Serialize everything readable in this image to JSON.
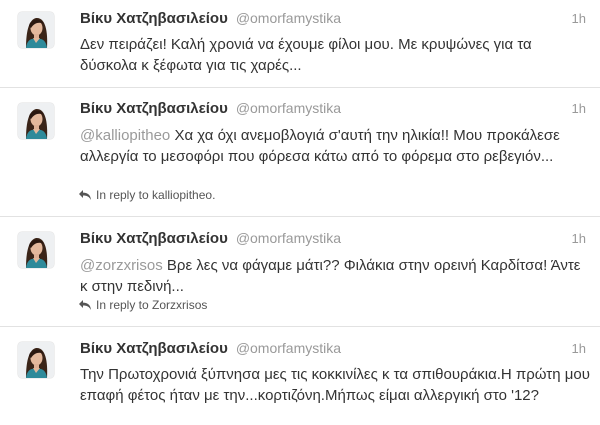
{
  "colors": {
    "name": "#333333",
    "handle": "#999999",
    "mention": "#9a9a9a",
    "divider": "#e2e2e2"
  },
  "tweets": [
    {
      "name": "Βίκυ Χατζηβασιλείου",
      "handle": "@omorfamystika",
      "time": "1h",
      "text": "Δεν πειράζει! Καλή χρονιά να έχουμε φίλοι μου. Με κρυψώνες για τα δύσκολα κ ξέφωτα για τις χαρές..."
    },
    {
      "name": "Βίκυ Χατζηβασιλείου",
      "handle": "@omorfamystika",
      "time": "1h",
      "mention": "@kalliopitheo",
      "text": " Χα χα όχι ανεμοβλογιά σ'αυτή την ηλικία!! Μου προκάλεσε αλλεργία το μεσοφόρι που φόρεσα κάτω από το φόρεμα στο ρεβεγιόν...",
      "reply": "In reply to kalliopitheo."
    },
    {
      "name": "Βίκυ Χατζηβασιλείου",
      "handle": "@omorfamystika",
      "time": "1h",
      "mention": "@zorzxrisos",
      "text": " Βρε λες να φάγαμε μάτι?? Φιλάκια στην ορεινή Καρδίτσα! Άντε κ στην πεδινή...",
      "reply": "In reply to Zorzxrisos"
    },
    {
      "name": "Βίκυ Χατζηβασιλείου",
      "handle": "@omorfamystika",
      "time": "1h",
      "text": "Την Πρωτοχρονιά ξύπνησα μες τις κοκκινίλες κ τα σπιθουράκια.Η πρώτη μου επαφή φέτος ήταν με την...κορτιζόνη.Μήπως είμαι αλλεργική στο '12?"
    }
  ]
}
